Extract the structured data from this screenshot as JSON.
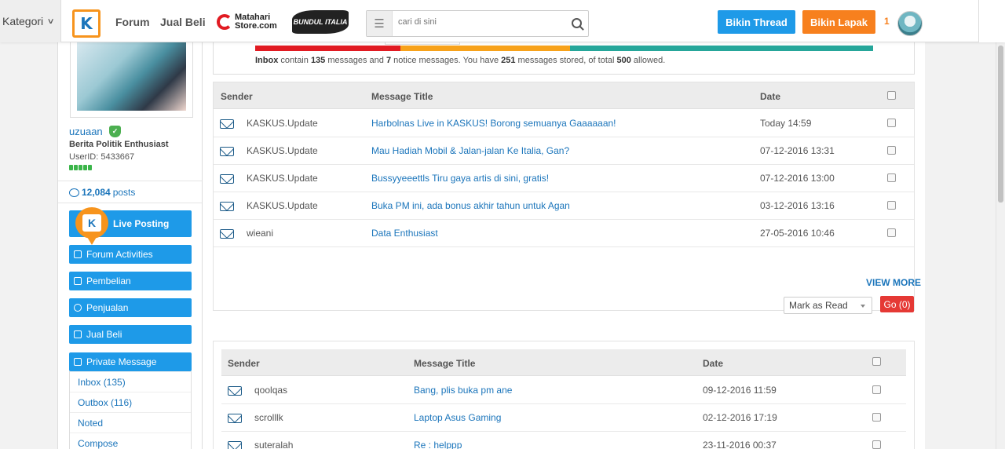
{
  "topbar": {
    "kategori_label": "Kategori",
    "logo_text": "K",
    "nav": [
      "Forum",
      "Jual Beli"
    ],
    "matahari_line1": "Matahari",
    "matahari_line2": "Store.com",
    "bundul_text": "BUNDUL ITALIA",
    "search_placeholder": "cari di sini",
    "bikin_thread": "Bikin Thread",
    "bikin_lapak": "Bikin Lapak",
    "notif_count": "1"
  },
  "profile": {
    "username": "uzuaan",
    "user_title": "Berita Politik Enthusiast",
    "user_id": "UserID: 5433667",
    "posts_count": "12,084",
    "posts_label": "posts"
  },
  "sidebar": {
    "live_posting": "Live Posting",
    "forum_activities": "Forum Activities",
    "pembelian": "Pembelian",
    "penjualan": "Penjualan",
    "jual_beli": "Jual Beli",
    "private_message": "Private Message",
    "pm_items": [
      "Inbox (135)",
      "Outbox (116)",
      "Noted",
      "Compose"
    ]
  },
  "quota": {
    "inbox_word": "Inbox",
    "text1": " contain ",
    "messages": "135",
    "text2": " messages and ",
    "notices": "7",
    "text3": " notice messages. You have ",
    "stored": "251",
    "text4": " messages stored, of total ",
    "total": "500",
    "text5": " allowed.",
    "segments": [
      0.235,
      0.275,
      0.49
    ]
  },
  "inbox_table": {
    "headers": {
      "sender": "Sender",
      "title": "Message Title",
      "date": "Date"
    },
    "rows": [
      {
        "sender": "KASKUS.Update",
        "title": "Harbolnas Live in KASKUS! Borong semuanya Gaaaaaan!",
        "date": "Today 14:59"
      },
      {
        "sender": "KASKUS.Update",
        "title": "Mau Hadiah Mobil & Jalan-jalan Ke Italia, Gan?",
        "date": "07-12-2016 13:31"
      },
      {
        "sender": "KASKUS.Update",
        "title": "Bussyyeeettls Tiru gaya artis di sini, gratis!",
        "date": "07-12-2016 13:00"
      },
      {
        "sender": "KASKUS.Update",
        "title": "Buka PM ini, ada bonus akhir tahun untuk Agan",
        "date": "03-12-2016 13:16"
      },
      {
        "sender": "wieani",
        "title": "Data Enthusiast",
        "date": "27-05-2016 10:46"
      }
    ]
  },
  "actions": {
    "view_more": "VIEW MORE",
    "mark_as_read": "Mark as Read",
    "go": "Go (0)"
  },
  "outbox_table": {
    "headers": {
      "sender": "Sender",
      "title": "Message Title",
      "date": "Date"
    },
    "rows": [
      {
        "sender": "qoolqas",
        "title": "Bang, plis buka pm ane",
        "date": "09-12-2016 11:59"
      },
      {
        "sender": "scrolllk",
        "title": "Laptop Asus Gaming",
        "date": "02-12-2016 17:19"
      },
      {
        "sender": "suteralah",
        "title": "Re : helppp",
        "date": "23-11-2016 00:37"
      }
    ]
  }
}
